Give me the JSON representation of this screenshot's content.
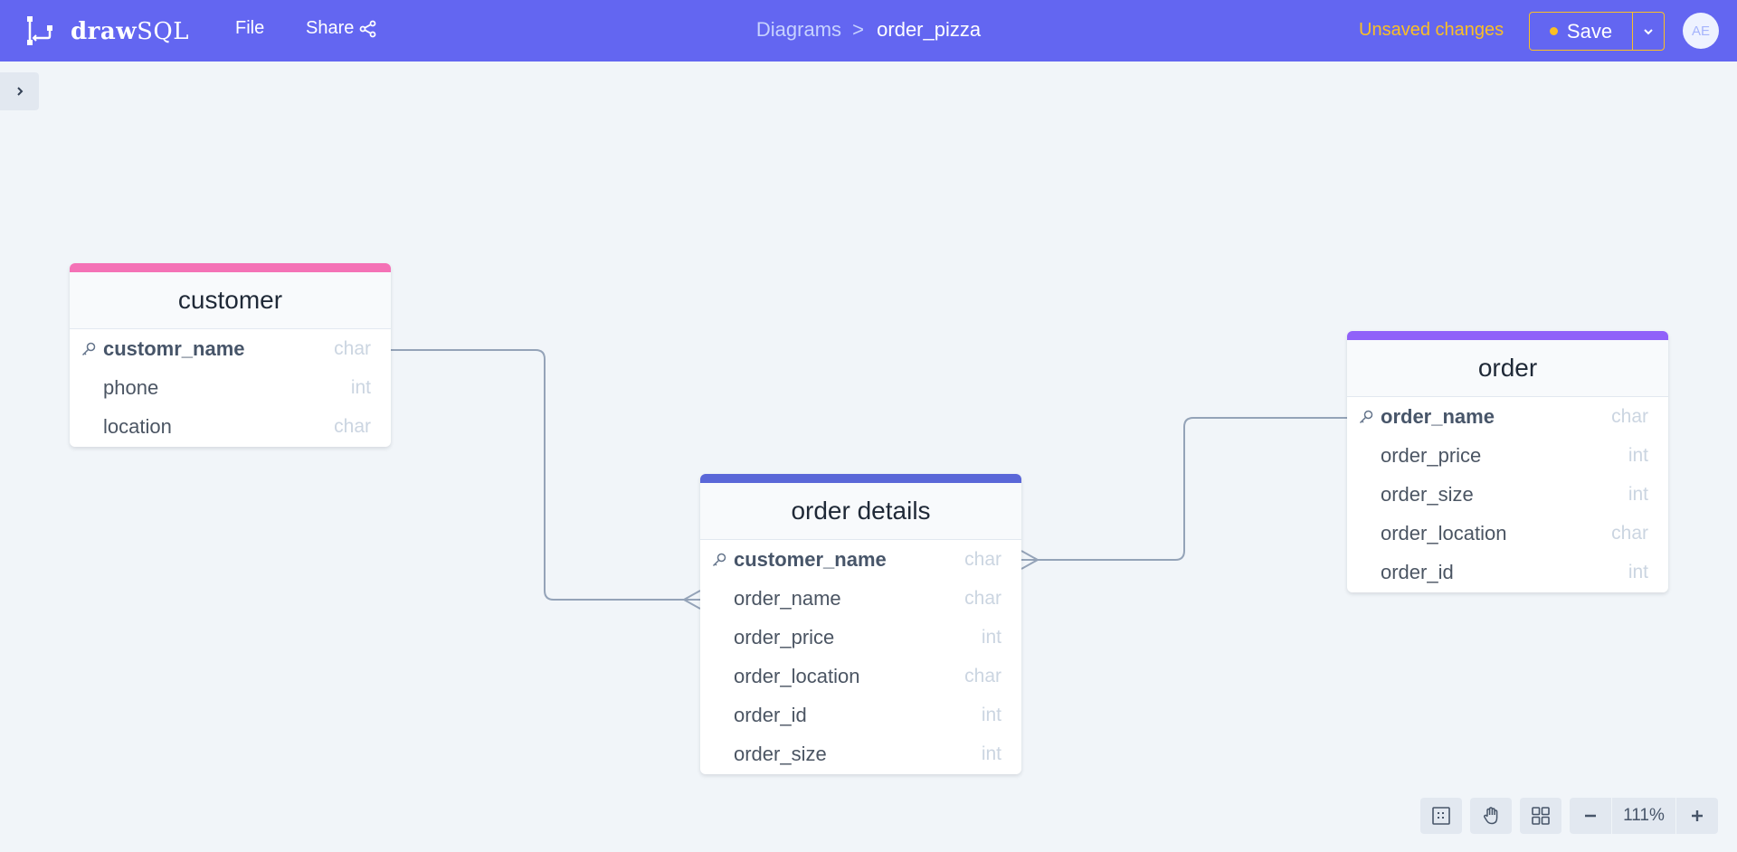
{
  "app": {
    "brand_bold": "draw",
    "brand_light": "SQL",
    "menu": {
      "file_label": "File",
      "share_label": "Share"
    },
    "breadcrumb": {
      "parent": "Diagrams",
      "separator": ">",
      "current": "order_pizza"
    },
    "status": "Unsaved changes",
    "save_label": "Save",
    "avatar_initials": "AE",
    "colors": {
      "header": "#6366f1",
      "accent": "#fbbf24",
      "canvas": "#f1f5f9"
    }
  },
  "tables": {
    "customer": {
      "name": "customer",
      "color": "#f472b6",
      "columns": [
        {
          "name": "customr_name",
          "type": "char",
          "primary_key": true
        },
        {
          "name": "phone",
          "type": "int"
        },
        {
          "name": "location",
          "type": "char"
        }
      ]
    },
    "order_details": {
      "name": "order details",
      "color": "#5a67d8",
      "columns": [
        {
          "name": "customer_name",
          "type": "char",
          "primary_key": true
        },
        {
          "name": "order_name",
          "type": "char"
        },
        {
          "name": "order_price",
          "type": "int"
        },
        {
          "name": "order_location",
          "type": "char"
        },
        {
          "name": "order_id",
          "type": "int"
        },
        {
          "name": "order_size",
          "type": "int"
        }
      ]
    },
    "order": {
      "name": "order",
      "color": "#9061f9",
      "columns": [
        {
          "name": "order_name",
          "type": "char",
          "primary_key": true
        },
        {
          "name": "order_price",
          "type": "int"
        },
        {
          "name": "order_size",
          "type": "int"
        },
        {
          "name": "order_location",
          "type": "char"
        },
        {
          "name": "order_id",
          "type": "int"
        }
      ]
    }
  },
  "relations": [
    {
      "from": "customer.customr_name",
      "to": "order_details.order_name",
      "cardinality": "one-to-many"
    },
    {
      "from": "order.order_name",
      "to": "order_details.customer_name",
      "cardinality": "one-to-many"
    }
  ],
  "toolbar": {
    "zoom_level": "111%",
    "tools": [
      "select-tool-icon",
      "pan-hand-icon",
      "grid-layout-icon"
    ]
  }
}
